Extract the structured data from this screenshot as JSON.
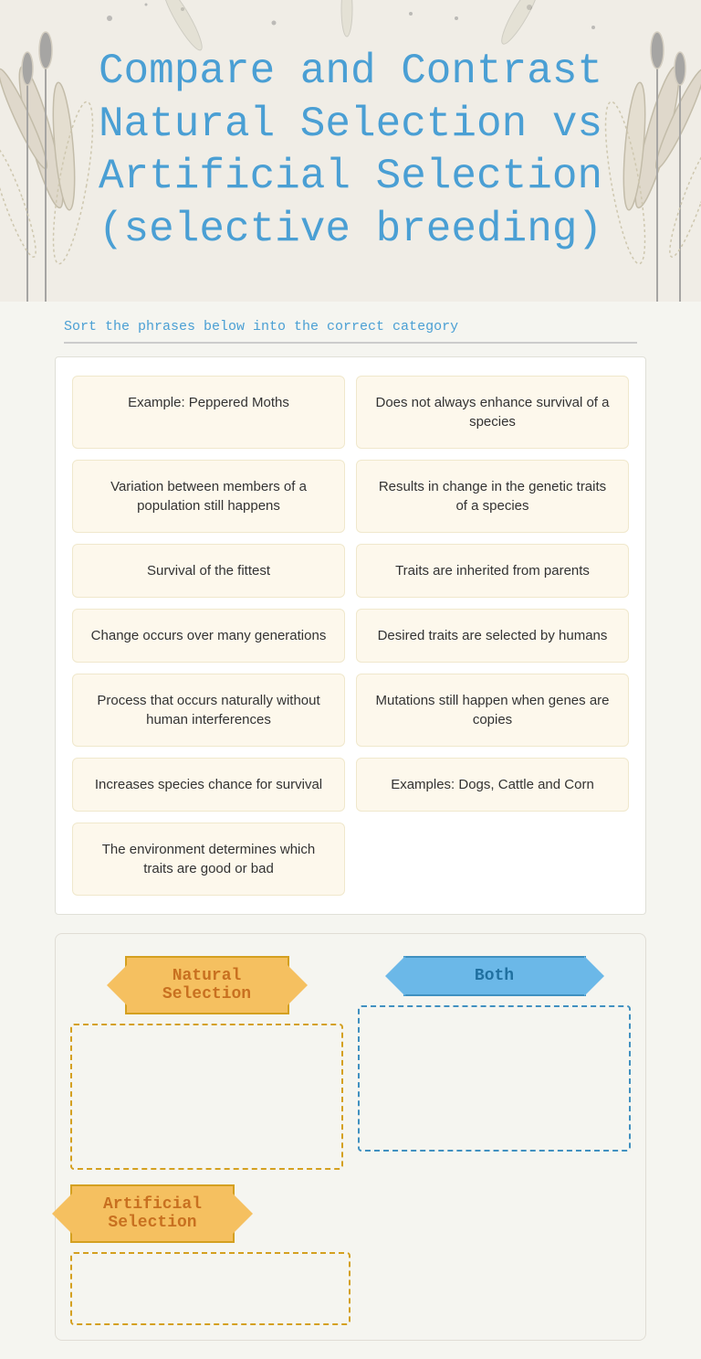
{
  "header": {
    "title": "Compare and Contrast Natural Selection vs Artificial Selection (selective breeding)"
  },
  "subtitle": {
    "text": "Sort the phrases below into the correct category"
  },
  "cards": [
    {
      "id": "c1",
      "text": "Example: Peppered Moths",
      "col": 0
    },
    {
      "id": "c2",
      "text": "Does not always enhance survival of a species",
      "col": 1
    },
    {
      "id": "c3",
      "text": "Variation between members of a population still happens",
      "col": 0
    },
    {
      "id": "c4",
      "text": "Results in change in the genetic traits of a species",
      "col": 1
    },
    {
      "id": "c5",
      "text": "Survival of the fittest",
      "col": 0
    },
    {
      "id": "c6",
      "text": "Traits are inherited from parents",
      "col": 1
    },
    {
      "id": "c7",
      "text": "Change occurs over many generations",
      "col": 0
    },
    {
      "id": "c8",
      "text": "Desired traits are selected by humans",
      "col": 1
    },
    {
      "id": "c9",
      "text": "Process that occurs naturally without human interferences",
      "col": 0
    },
    {
      "id": "c10",
      "text": "Mutations still happen when genes are copies",
      "col": 1
    },
    {
      "id": "c11",
      "text": "Increases species chance for survival",
      "col": 0
    },
    {
      "id": "c12",
      "text": "Examples: Dogs, Cattle and Corn",
      "col": 1
    },
    {
      "id": "c13",
      "text": "The environment determines which traits are good or bad",
      "col": 0
    }
  ],
  "sort_labels": {
    "natural": "Natural Selection",
    "both": "Both",
    "artificial": "Artificial Selection"
  }
}
